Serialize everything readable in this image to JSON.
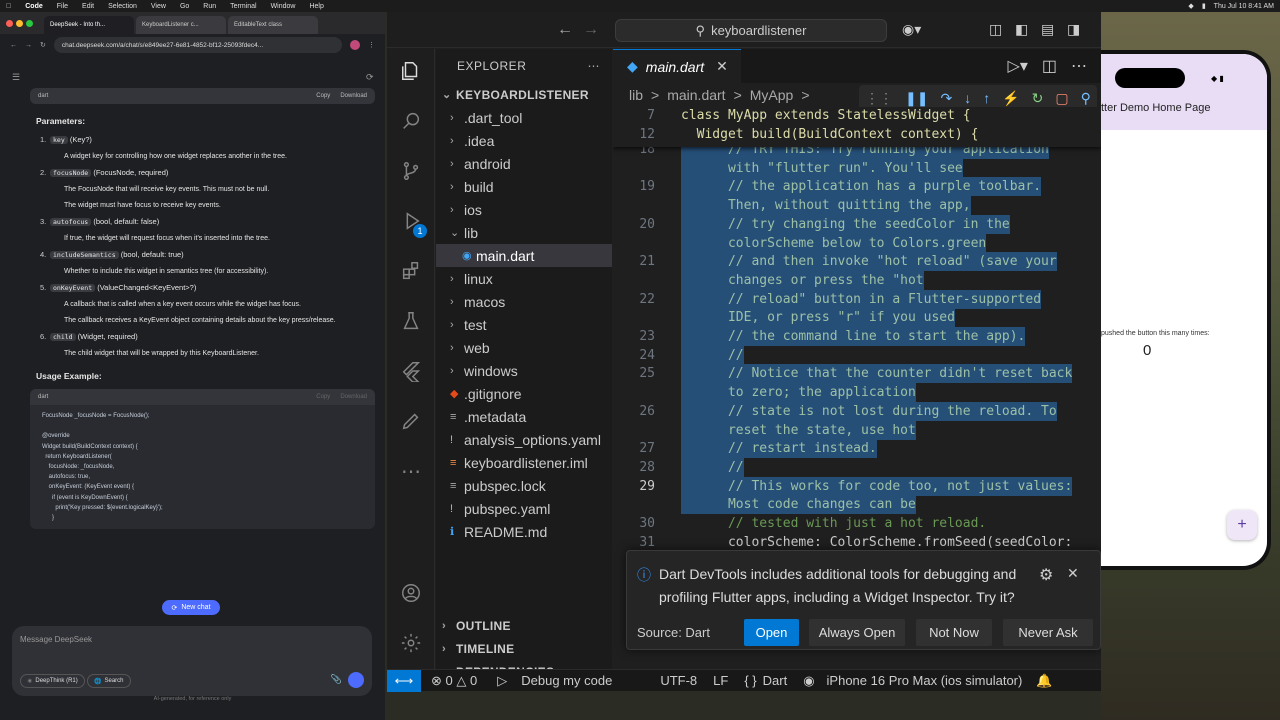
{
  "menubar": {
    "app": "Code",
    "items": [
      "File",
      "Edit",
      "Selection",
      "View",
      "Go",
      "Run",
      "Terminal",
      "Window",
      "Help"
    ],
    "clock": "Thu Jul 10  8:41 AM"
  },
  "browser": {
    "tabs": [
      "DeepSeek - Into th...",
      "KeyboardListener c...",
      "EditableText class"
    ],
    "url": "chat.deepseek.com/a/chat/s/e849ee27-6e81-4852-bf12-25093fdec4...",
    "code_lang": "dart",
    "copy_label": "Copy",
    "download_label": "Download",
    "params_heading": "Parameters:",
    "params": [
      {
        "num": "1.",
        "code": "key",
        "type": "(Key?)",
        "desc": "A widget key for controlling how one widget replaces another in the tree."
      },
      {
        "num": "2.",
        "code": "focusNode",
        "type": "(FocusNode, required)",
        "subs": [
          "The FocusNode that will receive key events. This must not be null.",
          "The widget must have focus to receive key events."
        ]
      },
      {
        "num": "3.",
        "code": "autofocus",
        "type": "(bool, default: false)",
        "desc": "If true, the widget will request focus when it's inserted into the tree."
      },
      {
        "num": "4.",
        "code": "includeSemantics",
        "type": "(bool, default: true)",
        "desc": "Whether to include this widget in semantics tree (for accessibility)."
      },
      {
        "num": "5.",
        "code": "onKeyEvent",
        "type": "(ValueChanged<KeyEvent>?)",
        "subs": [
          "A callback that is called when a key event occurs while the widget has focus.",
          "The callback receives a KeyEvent object containing details about the key press/release."
        ]
      },
      {
        "num": "6.",
        "code": "child",
        "type": "(Widget, required)",
        "desc": "The child widget that will be wrapped by this KeyboardListener."
      }
    ],
    "usage_heading": "Usage Example:",
    "example_code": "FocusNode _focusNode = FocusNode();\n\n@override\nWidget build(BuildContext context) {\n  return KeyboardListener(\n    focusNode: _focusNode,\n    autofocus: true,\n    onKeyEvent: (KeyEvent event) {\n      if (event is KeyDownEvent) {\n        print('Key pressed: ${event.logicalKey}');\n      }",
    "new_chat": "New chat",
    "message_placeholder": "Message DeepSeek",
    "deepthink": "DeepThink (R1)",
    "search": "Search",
    "disclaimer": "AI-generated, for reference only"
  },
  "vscode": {
    "search_title": "keyboardlistener",
    "explorer_title": "EXPLORER",
    "project": "KEYBOARDLISTENER",
    "tree": [
      {
        "name": ".dart_tool",
        "kind": "folder",
        "depth": 1
      },
      {
        "name": ".idea",
        "kind": "folder",
        "depth": 1
      },
      {
        "name": "android",
        "kind": "folder",
        "depth": 1
      },
      {
        "name": "build",
        "kind": "folder",
        "depth": 1
      },
      {
        "name": "ios",
        "kind": "folder",
        "depth": 1
      },
      {
        "name": "lib",
        "kind": "folder-open",
        "depth": 1
      },
      {
        "name": "main.dart",
        "kind": "dart",
        "depth": 2,
        "selected": true
      },
      {
        "name": "linux",
        "kind": "folder",
        "depth": 1
      },
      {
        "name": "macos",
        "kind": "folder",
        "depth": 1
      },
      {
        "name": "test",
        "kind": "folder",
        "depth": 1
      },
      {
        "name": "web",
        "kind": "folder",
        "depth": 1
      },
      {
        "name": "windows",
        "kind": "folder",
        "depth": 1
      },
      {
        "name": ".gitignore",
        "kind": "git",
        "depth": 1
      },
      {
        "name": ".metadata",
        "kind": "file",
        "depth": 1
      },
      {
        "name": "analysis_options.yaml",
        "kind": "yaml",
        "depth": 1
      },
      {
        "name": "keyboardlistener.iml",
        "kind": "iml",
        "depth": 1
      },
      {
        "name": "pubspec.lock",
        "kind": "lock",
        "depth": 1
      },
      {
        "name": "pubspec.yaml",
        "kind": "yaml",
        "depth": 1
      },
      {
        "name": "README.md",
        "kind": "md",
        "depth": 1
      }
    ],
    "sections": [
      "OUTLINE",
      "TIMELINE",
      "DEPENDENCIES"
    ],
    "tab": "main.dart",
    "breadcrumb": [
      "lib",
      ">",
      "main.dart",
      ">",
      "MyApp",
      ">"
    ],
    "sticky": [
      {
        "n": "7",
        "text": "class MyApp extends StatelessWidget {"
      },
      {
        "n": "12",
        "text": "  Widget build(BuildContext context) {"
      }
    ],
    "lines": [
      {
        "n": "18",
        "text": "      // TRY THIS: Try running your application",
        "sel": true
      },
      {
        "n": "",
        "text": "      with \"flutter run\". You'll see",
        "sel": true
      },
      {
        "n": "19",
        "text": "      // the application has a purple toolbar.",
        "sel": true
      },
      {
        "n": "",
        "text": "      Then, without quitting the app,",
        "sel": true
      },
      {
        "n": "20",
        "text": "      // try changing the seedColor in the",
        "sel": true
      },
      {
        "n": "",
        "text": "      colorScheme below to Colors.green",
        "sel": true
      },
      {
        "n": "21",
        "text": "      // and then invoke \"hot reload\" (save your",
        "sel": true
      },
      {
        "n": "",
        "text": "      changes or press the \"hot",
        "sel": true
      },
      {
        "n": "22",
        "text": "      // reload\" button in a Flutter-supported",
        "sel": true
      },
      {
        "n": "",
        "text": "      IDE, or press \"r\" if you used",
        "sel": true
      },
      {
        "n": "23",
        "text": "      // the command line to start the app).",
        "sel": true
      },
      {
        "n": "24",
        "text": "      //",
        "sel": true
      },
      {
        "n": "25",
        "text": "      // Notice that the counter didn't reset back",
        "sel": true
      },
      {
        "n": "",
        "text": "      to zero; the application",
        "sel": true
      },
      {
        "n": "26",
        "text": "      // state is not lost during the reload. To",
        "sel": true
      },
      {
        "n": "",
        "text": "      reset the state, use hot",
        "sel": true
      },
      {
        "n": "27",
        "text": "      // restart instead.",
        "sel": true
      },
      {
        "n": "28",
        "text": "      //",
        "sel": true
      },
      {
        "n": "29",
        "text": "      // This works for code too, not just values:",
        "sel": true,
        "cur": true
      },
      {
        "n": "",
        "text": "      Most code changes can be",
        "sel": true
      },
      {
        "n": "30",
        "text": "      // tested with just a hot reload.",
        "sel": false
      },
      {
        "n": "31",
        "text": "      colorScheme: ColorScheme.fromSeed(seedColor:",
        "sel": false
      }
    ],
    "toast": {
      "message": "Dart DevTools includes additional tools for debugging and profiling Flutter apps, including a Widget Inspector. Try it?",
      "source": "Source: Dart",
      "open": "Open",
      "always_open": "Always Open",
      "not_now": "Not Now",
      "never_ask": "Never Ask"
    },
    "status": {
      "errors": "0",
      "warnings": "0",
      "debug": "Debug my code",
      "encoding": "UTF-8",
      "eol": "LF",
      "language": "Dart",
      "device": "iPhone 16 Pro Max (ios simulator)"
    }
  },
  "simulator": {
    "app_title": "tter Demo Home Page",
    "counter_label": "pushed the button this many times:",
    "counter": "0",
    "fab": "+"
  },
  "colors": {
    "vscode_accent": "#0078d4",
    "selection": "#264f78",
    "deepseek_blue": "#4d6bfe",
    "flutter_appbar": "#e9dcf5"
  }
}
